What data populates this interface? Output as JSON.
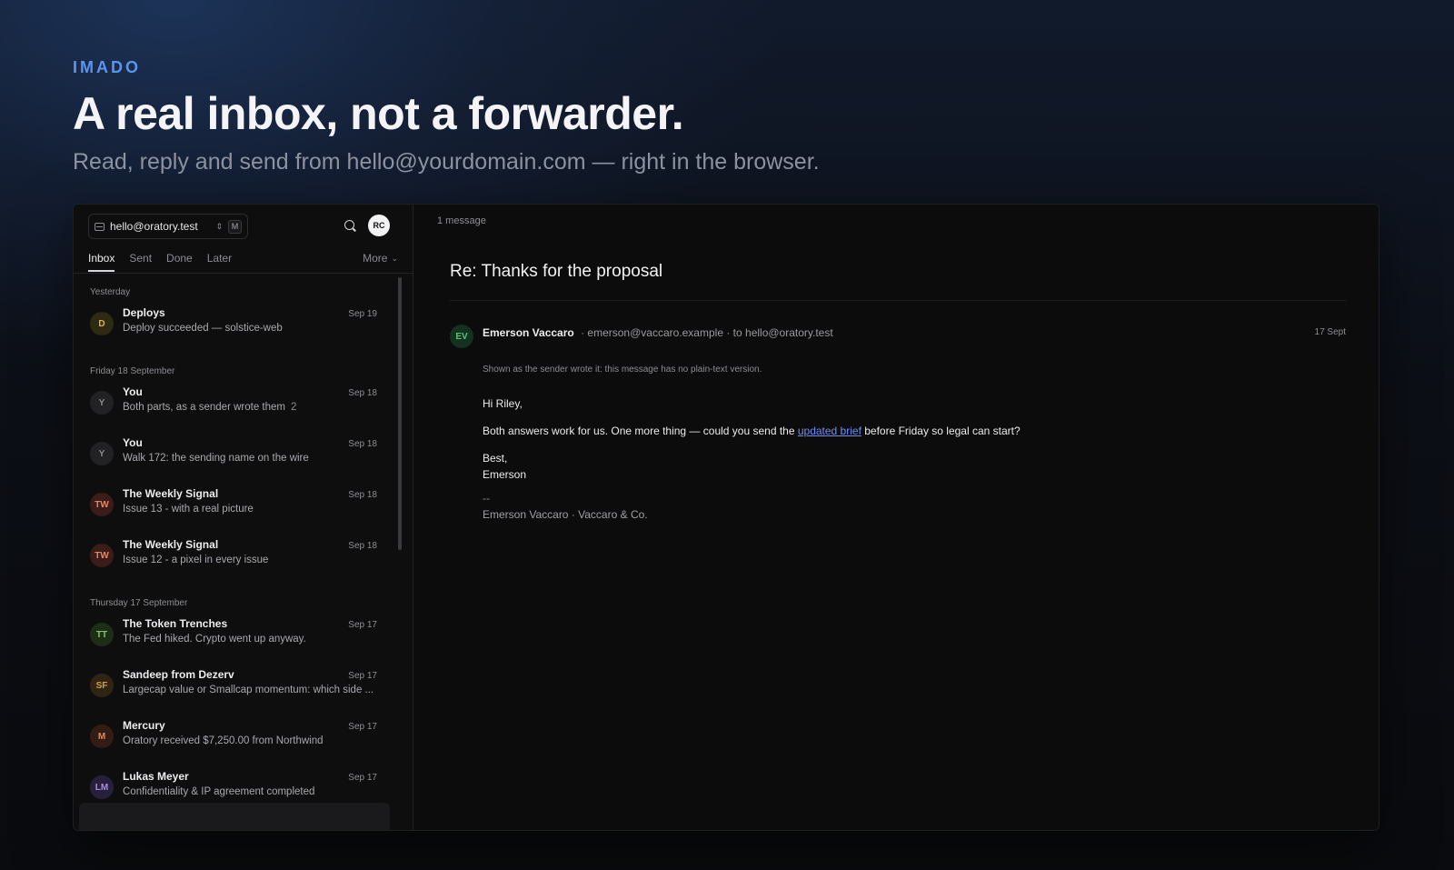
{
  "hero": {
    "brand": "IMADO",
    "headline": "A real inbox, not a forwarder.",
    "subline": "Read, reply and send from hello@yourdomain.com — right in the browser."
  },
  "sidebar": {
    "account": "hello@oratory.test",
    "account_shortcut": "M",
    "user_initials": "RC",
    "tabs": [
      "Inbox",
      "Sent",
      "Done",
      "Later"
    ],
    "more_label": "More",
    "groups": [
      {
        "label": "Yesterday",
        "items": [
          {
            "initials": "D",
            "from": "Deploys",
            "snippet": "Deploy succeeded — solstice-web",
            "count": "",
            "date": "Sep 19",
            "bg": "#2f2a12",
            "fg": "#d6b84a"
          }
        ]
      },
      {
        "label": "Friday 18 September",
        "items": [
          {
            "initials": "Y",
            "from": "You",
            "snippet": "Both parts, as a sender wrote them",
            "count": "2",
            "date": "Sep 18",
            "bg": "#222224",
            "fg": "#8a8a90"
          },
          {
            "initials": "Y",
            "from": "You",
            "snippet": "Walk 172: the sending name on the wire",
            "count": "",
            "date": "Sep 18",
            "bg": "#222224",
            "fg": "#8a8a90"
          },
          {
            "initials": "TW",
            "from": "The Weekly Signal",
            "snippet": "Issue 13 - with a real picture",
            "count": "",
            "date": "Sep 18",
            "bg": "#3a1d18",
            "fg": "#e48566"
          },
          {
            "initials": "TW",
            "from": "The Weekly Signal",
            "snippet": "Issue 12 - a pixel in every issue",
            "count": "",
            "date": "Sep 18",
            "bg": "#3a1d18",
            "fg": "#e48566"
          }
        ]
      },
      {
        "label": "Thursday 17 September",
        "items": [
          {
            "initials": "TT",
            "from": "The Token Trenches",
            "snippet": "The Fed hiked. Crypto went up anyway.",
            "count": "",
            "date": "Sep 17",
            "bg": "#1d2e17",
            "fg": "#86c166"
          },
          {
            "initials": "SF",
            "from": "Sandeep from Dezerv",
            "snippet": "Largecap value or Smallcap momentum: which side ...",
            "count": "",
            "date": "Sep 17",
            "bg": "#2f2512",
            "fg": "#d0a04a"
          },
          {
            "initials": "M",
            "from": "Mercury",
            "snippet": "Oratory received $7,250.00 from Northwind",
            "count": "",
            "date": "Sep 17",
            "bg": "#321c14",
            "fg": "#e08a5c"
          },
          {
            "initials": "LM",
            "from": "Lukas Meyer",
            "snippet": "Confidentiality & IP agreement completed",
            "count": "",
            "date": "Sep 17",
            "bg": "#28203a",
            "fg": "#a88ee0"
          }
        ]
      }
    ]
  },
  "reader": {
    "message_count": "1 message",
    "subject": "Re: Thanks for the proposal",
    "sender_initials": "EV",
    "sender_name": "Emerson Vaccaro",
    "sender_email": "· emerson@vaccaro.example",
    "recipient": "· to hello@oratory.test",
    "date": "17 Sept",
    "notice": "Shown as the sender wrote it: this message has no plain-text version.",
    "greeting": "Hi Riley,",
    "body_before_link": "Both answers work for us. One more thing — could you send the ",
    "link_text": "updated brief",
    "body_after_link": " before Friday so legal can start?",
    "closing": "Best,",
    "closing_name": "Emerson",
    "sig_dash": "--",
    "signature": "Emerson Vaccaro · Vaccaro & Co."
  }
}
